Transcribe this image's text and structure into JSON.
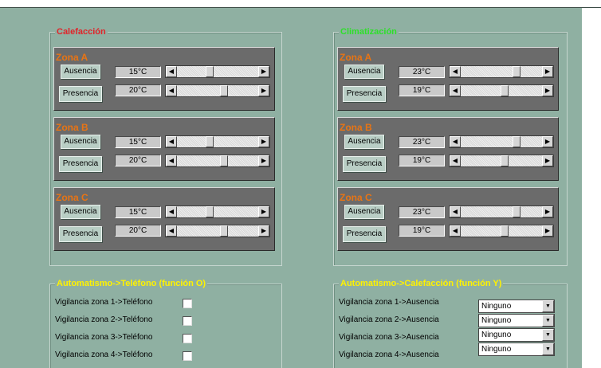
{
  "colors": {
    "calefaccion_title": "#e0242a",
    "climatizacion_title": "#2ee02a",
    "automatismo_title": "#fff200",
    "zone_title": "#e87414"
  },
  "calefaccion": {
    "title": "Calefacción",
    "zones": [
      {
        "name": "Zona A",
        "ausencia_label": "Ausencia",
        "ausencia_value": "15°C",
        "ausencia_level": 0.4,
        "presencia_label": "Presencia",
        "presencia_value": "20°C",
        "presencia_level": 0.6
      },
      {
        "name": "Zona B",
        "ausencia_label": "Ausencia",
        "ausencia_value": "15°C",
        "ausencia_level": 0.4,
        "presencia_label": "Presencia",
        "presencia_value": "20°C",
        "presencia_level": 0.6
      },
      {
        "name": "Zona C",
        "ausencia_label": "Ausencia",
        "ausencia_value": "15°C",
        "ausencia_level": 0.4,
        "presencia_label": "Presencia",
        "presencia_value": "20°C",
        "presencia_level": 0.6
      }
    ]
  },
  "climatizacion": {
    "title": "Climatización",
    "zones": [
      {
        "name": "Zona A",
        "ausencia_label": "Ausencia",
        "ausencia_value": "23°C",
        "ausencia_level": 0.72,
        "presencia_label": "Presencia",
        "presencia_value": "19°C",
        "presencia_level": 0.55
      },
      {
        "name": "Zona B",
        "ausencia_label": "Ausencia",
        "ausencia_value": "23°C",
        "ausencia_level": 0.72,
        "presencia_label": "Presencia",
        "presencia_value": "19°C",
        "presencia_level": 0.55
      },
      {
        "name": "Zona C",
        "ausencia_label": "Ausencia",
        "ausencia_value": "23°C",
        "ausencia_level": 0.72,
        "presencia_label": "Presencia",
        "presencia_value": "19°C",
        "presencia_level": 0.55
      }
    ]
  },
  "telefono": {
    "title": "Automatismo->Teléfono (función O)",
    "rows": [
      {
        "label": "Vigilancia zona 1->Teléfono",
        "checked": false
      },
      {
        "label": "Vigilancia zona 2->Teléfono",
        "checked": false
      },
      {
        "label": "Vigilancia zona 3->Teléfono",
        "checked": false
      },
      {
        "label": "Vigilancia zona 4->Teléfono",
        "checked": false
      }
    ]
  },
  "calefaccion_auto": {
    "title": "Automatismo->Calefacción (función Y)",
    "rows": [
      {
        "label": "Vigilancia zona 1->Ausencia",
        "value": "Ninguno"
      },
      {
        "label": "Vigilancia zona 2->Ausencia",
        "value": "Ninguno"
      },
      {
        "label": "Vigilancia zona 3->Ausencia",
        "value": "Ninguno"
      },
      {
        "label": "Vigilancia zona 4->Ausencia",
        "value": "Ninguno"
      }
    ]
  }
}
